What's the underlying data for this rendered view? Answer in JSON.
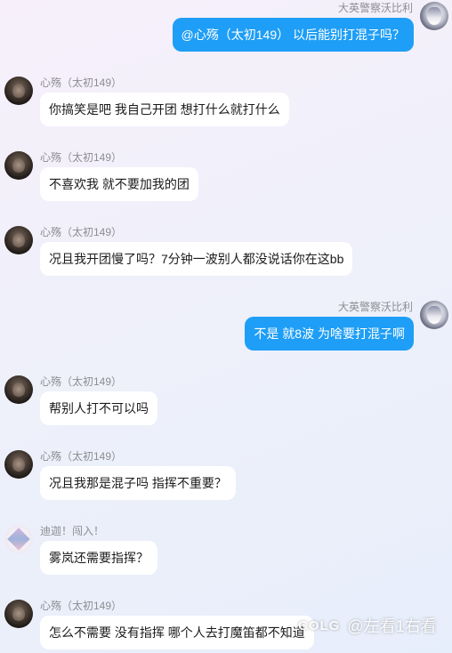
{
  "messages": [
    {
      "sender": "大英警察沃比利",
      "text": "@心殇（太初149） 以后能别打混子吗？",
      "side": "right"
    },
    {
      "sender": "心殇（太初149）",
      "text": "你搞笑是吧  我自己开团  想打什么就打什么",
      "side": "left"
    },
    {
      "sender": "心殇（太初149）",
      "text": "不喜欢我  就不要加我的团",
      "side": "left"
    },
    {
      "sender": "心殇（太初149）",
      "text": "况且我开团慢了吗？7分钟一波别人都没说话你在这bb",
      "side": "left"
    },
    {
      "sender": "大英警察沃比利",
      "text": "不是  就8波 为啥要打混子啊",
      "side": "right"
    },
    {
      "sender": "心殇（太初149）",
      "text": "帮别人打不可以吗",
      "side": "left"
    },
    {
      "sender": "心殇（太初149）",
      "text": "况且我那是混子吗  指挥不重要？",
      "side": "left"
    },
    {
      "sender": "迪迦！闯入！",
      "text": "雾岚还需要指挥？",
      "side": "left"
    },
    {
      "sender": "心殇（太初149）",
      "text": "怎么不需要  没有指挥 哪个人去打魔笛都不知道",
      "side": "left"
    }
  ],
  "watermark": {
    "logo": "COLG",
    "text": "@左看1右看"
  },
  "colors": {
    "outgoing_bubble": "#1e9ef6",
    "incoming_bubble": "#ffffff",
    "name_text": "#8d8d93"
  }
}
